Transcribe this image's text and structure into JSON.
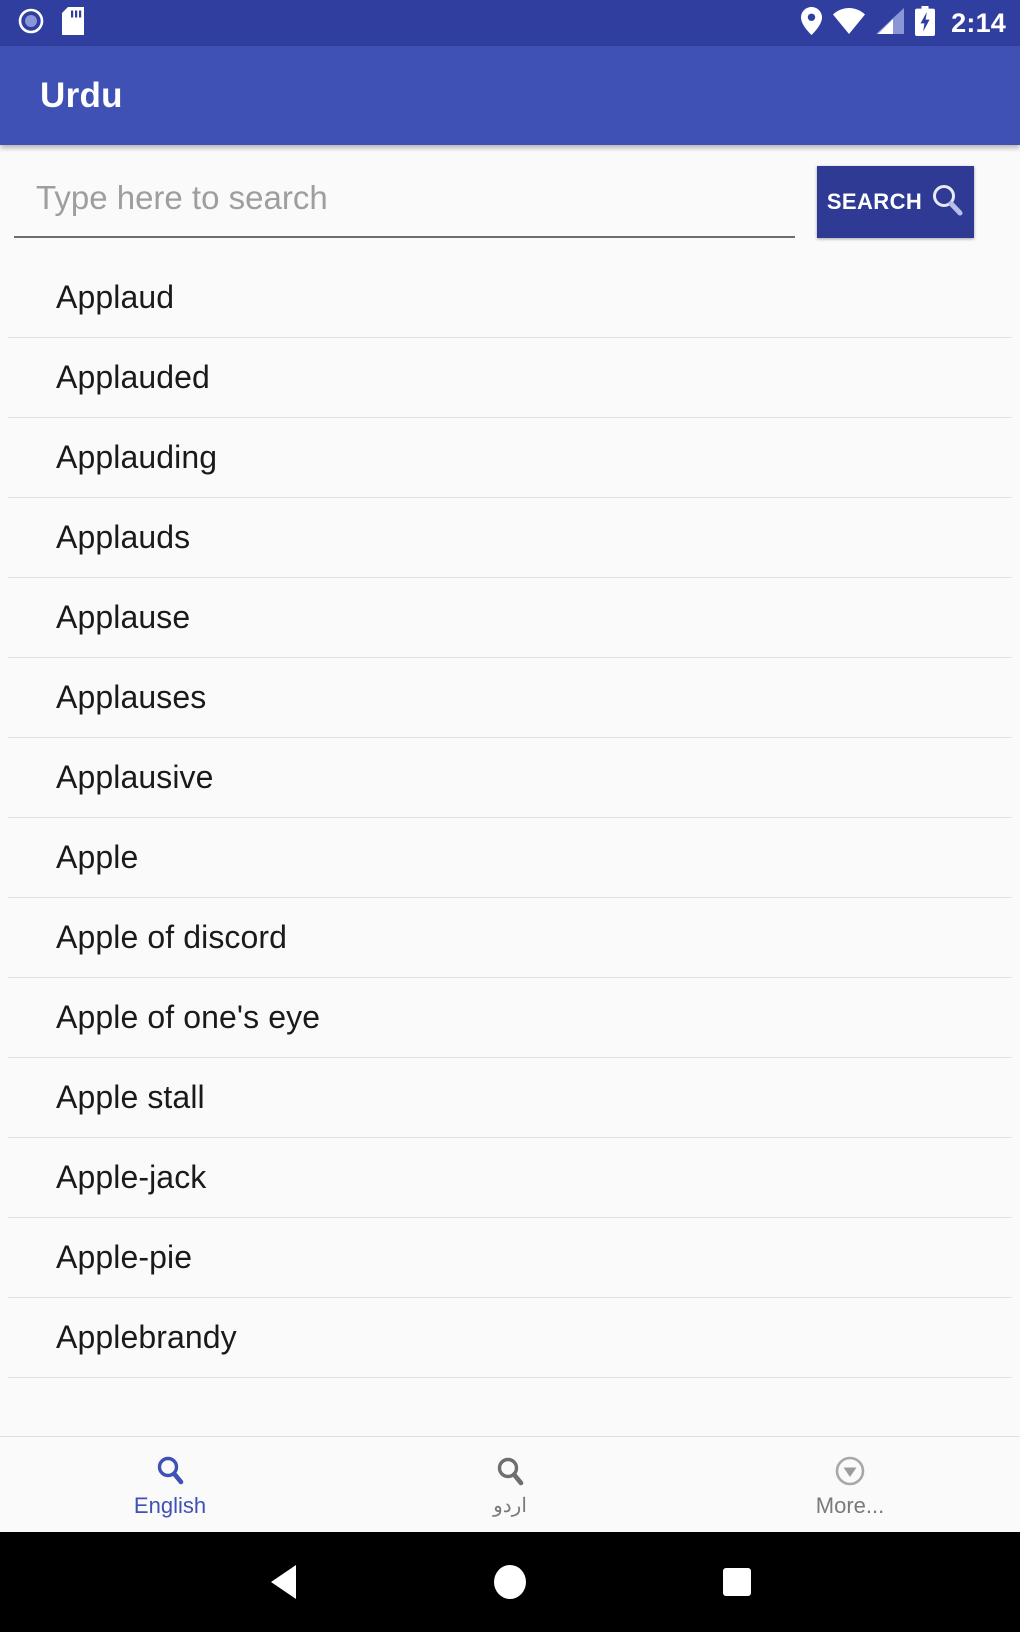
{
  "status_bar": {
    "icons_left": [
      "record-circle-icon",
      "sd-card-icon"
    ],
    "icons_right": [
      "location-pin-icon",
      "wifi-icon",
      "cellular-signal-icon",
      "battery-charging-icon"
    ],
    "time": "2:14",
    "background_color": "#303f9f"
  },
  "app_bar": {
    "title": "Urdu",
    "background_color": "#3f51b5",
    "title_color": "#ffffff"
  },
  "search": {
    "placeholder": "Type here to search",
    "value": "",
    "button_label": "SEARCH",
    "button_icon": "magnifier-icon",
    "button_color": "#2e3a94"
  },
  "word_list": {
    "items": [
      {
        "label": "Applaud"
      },
      {
        "label": "Applauded"
      },
      {
        "label": "Applauding"
      },
      {
        "label": "Applauds"
      },
      {
        "label": "Applause"
      },
      {
        "label": "Applauses"
      },
      {
        "label": "Applausive"
      },
      {
        "label": "Apple"
      },
      {
        "label": "Apple of discord"
      },
      {
        "label": "Apple of one's eye"
      },
      {
        "label": "Apple stall"
      },
      {
        "label": "Apple-jack"
      },
      {
        "label": "Apple-pie"
      },
      {
        "label": "Applebrandy"
      }
    ]
  },
  "bottom_nav": {
    "active_color": "#3f51b5",
    "inactive_color": "#7a7a7a",
    "tabs": [
      {
        "label": "English",
        "icon": "magnifier-icon",
        "active": true
      },
      {
        "label": "اردو",
        "icon": "magnifier-icon",
        "active": false
      },
      {
        "label": "More...",
        "icon": "circle-chevron-down-icon",
        "active": false
      }
    ]
  },
  "android_nav": {
    "buttons": [
      "back-triangle-icon",
      "home-circle-icon",
      "recents-square-icon"
    ],
    "background_color": "#000000"
  }
}
